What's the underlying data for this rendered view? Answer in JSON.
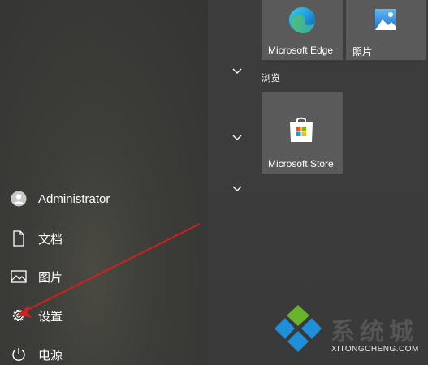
{
  "start_menu": {
    "user": {
      "label": "Administrator",
      "icon": "user-avatar-icon"
    },
    "items": [
      {
        "label": "文档",
        "icon": "document-icon"
      },
      {
        "label": "图片",
        "icon": "picture-icon"
      },
      {
        "label": "设置",
        "icon": "gear-icon"
      },
      {
        "label": "电源",
        "icon": "power-icon"
      }
    ]
  },
  "tiles": {
    "edge": {
      "label": "Microsoft Edge",
      "icon": "edge-icon"
    },
    "photos": {
      "label": "照片",
      "icon": "photos-icon"
    },
    "group_browse": {
      "label": "浏览"
    },
    "store": {
      "label": "Microsoft Store",
      "icon": "store-icon"
    }
  },
  "watermark": {
    "brand_cn": "系统城",
    "domain": "XITONGCHENG.COM"
  },
  "colors": {
    "tile_bg": "#5a5a5a",
    "arrow": "#d21f1f",
    "watermark_blue": "#1e8fd8",
    "watermark_green": "#6ab42c"
  }
}
